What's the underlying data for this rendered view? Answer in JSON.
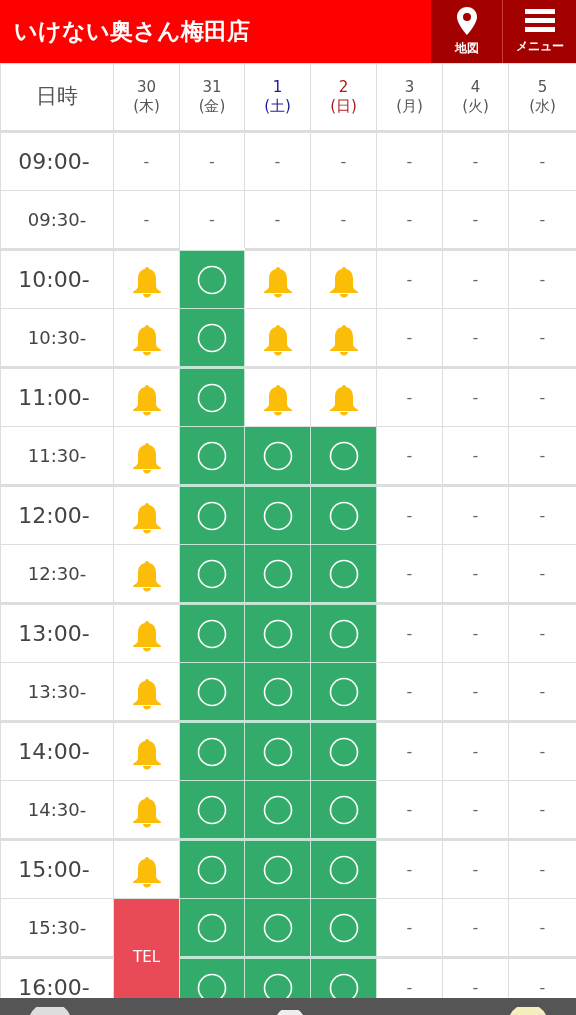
{
  "header": {
    "title": "いけない奥さん梅田店",
    "buttons": [
      {
        "kind": "map",
        "label": "地図"
      },
      {
        "kind": "menu",
        "label": "メニュー"
      }
    ]
  },
  "table": {
    "corner": "日時",
    "days": [
      {
        "date": "30",
        "weekday": "(木)",
        "color": "#555555"
      },
      {
        "date": "31",
        "weekday": "(金)",
        "color": "#555555"
      },
      {
        "date": "1",
        "weekday": "(土)",
        "color": "#1a1a9c"
      },
      {
        "date": "2",
        "weekday": "(日)",
        "color": "#b01818"
      },
      {
        "date": "3",
        "weekday": "(月)",
        "color": "#555555"
      },
      {
        "date": "4",
        "weekday": "(火)",
        "color": "#555555"
      },
      {
        "date": "5",
        "weekday": "(水)",
        "color": "#555555"
      }
    ],
    "rows": [
      {
        "time": "09:00-",
        "kind": "hour",
        "cells": [
          {
            "kind": "none",
            "text": "-"
          },
          {
            "kind": "none",
            "text": "-"
          },
          {
            "kind": "none",
            "text": "-"
          },
          {
            "kind": "none",
            "text": "-"
          },
          {
            "kind": "none",
            "text": "-"
          },
          {
            "kind": "none",
            "text": "-"
          },
          {
            "kind": "none",
            "text": "-"
          }
        ]
      },
      {
        "time": "09:30-",
        "kind": "half",
        "cells": [
          {
            "kind": "none",
            "text": "-"
          },
          {
            "kind": "none",
            "text": "-"
          },
          {
            "kind": "none",
            "text": "-"
          },
          {
            "kind": "none",
            "text": "-"
          },
          {
            "kind": "none",
            "text": "-"
          },
          {
            "kind": "none",
            "text": "-"
          },
          {
            "kind": "none",
            "text": "-"
          }
        ]
      },
      {
        "time": "10:00-",
        "kind": "hour",
        "cells": [
          {
            "kind": "bell"
          },
          {
            "kind": "open"
          },
          {
            "kind": "bell"
          },
          {
            "kind": "bell"
          },
          {
            "kind": "none",
            "text": "-"
          },
          {
            "kind": "none",
            "text": "-"
          },
          {
            "kind": "none",
            "text": "-"
          }
        ]
      },
      {
        "time": "10:30-",
        "kind": "half",
        "cells": [
          {
            "kind": "bell"
          },
          {
            "kind": "open"
          },
          {
            "kind": "bell"
          },
          {
            "kind": "bell"
          },
          {
            "kind": "none",
            "text": "-"
          },
          {
            "kind": "none",
            "text": "-"
          },
          {
            "kind": "none",
            "text": "-"
          }
        ]
      },
      {
        "time": "11:00-",
        "kind": "hour",
        "cells": [
          {
            "kind": "bell"
          },
          {
            "kind": "open"
          },
          {
            "kind": "bell"
          },
          {
            "kind": "bell"
          },
          {
            "kind": "none",
            "text": "-"
          },
          {
            "kind": "none",
            "text": "-"
          },
          {
            "kind": "none",
            "text": "-"
          }
        ]
      },
      {
        "time": "11:30-",
        "kind": "half",
        "cells": [
          {
            "kind": "bell"
          },
          {
            "kind": "open"
          },
          {
            "kind": "open"
          },
          {
            "kind": "open"
          },
          {
            "kind": "none",
            "text": "-"
          },
          {
            "kind": "none",
            "text": "-"
          },
          {
            "kind": "none",
            "text": "-"
          }
        ]
      },
      {
        "time": "12:00-",
        "kind": "hour",
        "cells": [
          {
            "kind": "bell"
          },
          {
            "kind": "open"
          },
          {
            "kind": "open"
          },
          {
            "kind": "open"
          },
          {
            "kind": "none",
            "text": "-"
          },
          {
            "kind": "none",
            "text": "-"
          },
          {
            "kind": "none",
            "text": "-"
          }
        ]
      },
      {
        "time": "12:30-",
        "kind": "half",
        "cells": [
          {
            "kind": "bell"
          },
          {
            "kind": "open"
          },
          {
            "kind": "open"
          },
          {
            "kind": "open"
          },
          {
            "kind": "none",
            "text": "-"
          },
          {
            "kind": "none",
            "text": "-"
          },
          {
            "kind": "none",
            "text": "-"
          }
        ]
      },
      {
        "time": "13:00-",
        "kind": "hour",
        "cells": [
          {
            "kind": "bell"
          },
          {
            "kind": "open"
          },
          {
            "kind": "open"
          },
          {
            "kind": "open"
          },
          {
            "kind": "none",
            "text": "-"
          },
          {
            "kind": "none",
            "text": "-"
          },
          {
            "kind": "none",
            "text": "-"
          }
        ]
      },
      {
        "time": "13:30-",
        "kind": "half",
        "cells": [
          {
            "kind": "bell"
          },
          {
            "kind": "open"
          },
          {
            "kind": "open"
          },
          {
            "kind": "open"
          },
          {
            "kind": "none",
            "text": "-"
          },
          {
            "kind": "none",
            "text": "-"
          },
          {
            "kind": "none",
            "text": "-"
          }
        ]
      },
      {
        "time": "14:00-",
        "kind": "hour",
        "cells": [
          {
            "kind": "bell"
          },
          {
            "kind": "open"
          },
          {
            "kind": "open"
          },
          {
            "kind": "open"
          },
          {
            "kind": "none",
            "text": "-"
          },
          {
            "kind": "none",
            "text": "-"
          },
          {
            "kind": "none",
            "text": "-"
          }
        ]
      },
      {
        "time": "14:30-",
        "kind": "half",
        "cells": [
          {
            "kind": "bell"
          },
          {
            "kind": "open"
          },
          {
            "kind": "open"
          },
          {
            "kind": "open"
          },
          {
            "kind": "none",
            "text": "-"
          },
          {
            "kind": "none",
            "text": "-"
          },
          {
            "kind": "none",
            "text": "-"
          }
        ]
      },
      {
        "time": "15:00-",
        "kind": "hour",
        "cells": [
          {
            "kind": "bell"
          },
          {
            "kind": "open"
          },
          {
            "kind": "open"
          },
          {
            "kind": "open"
          },
          {
            "kind": "none",
            "text": "-"
          },
          {
            "kind": "none",
            "text": "-"
          },
          {
            "kind": "none",
            "text": "-"
          }
        ]
      },
      {
        "time": "15:30-",
        "kind": "half",
        "cells": [
          {
            "kind": "tel",
            "text": "TEL",
            "rowspan": 2
          },
          {
            "kind": "open"
          },
          {
            "kind": "open"
          },
          {
            "kind": "open"
          },
          {
            "kind": "none",
            "text": "-"
          },
          {
            "kind": "none",
            "text": "-"
          },
          {
            "kind": "none",
            "text": "-"
          }
        ]
      },
      {
        "time": "16:00-",
        "kind": "hour",
        "cells": [
          {
            "kind": "open"
          },
          {
            "kind": "open"
          },
          {
            "kind": "open"
          },
          {
            "kind": "none",
            "text": "-"
          },
          {
            "kind": "none",
            "text": "-"
          },
          {
            "kind": "none",
            "text": "-"
          }
        ]
      }
    ]
  }
}
